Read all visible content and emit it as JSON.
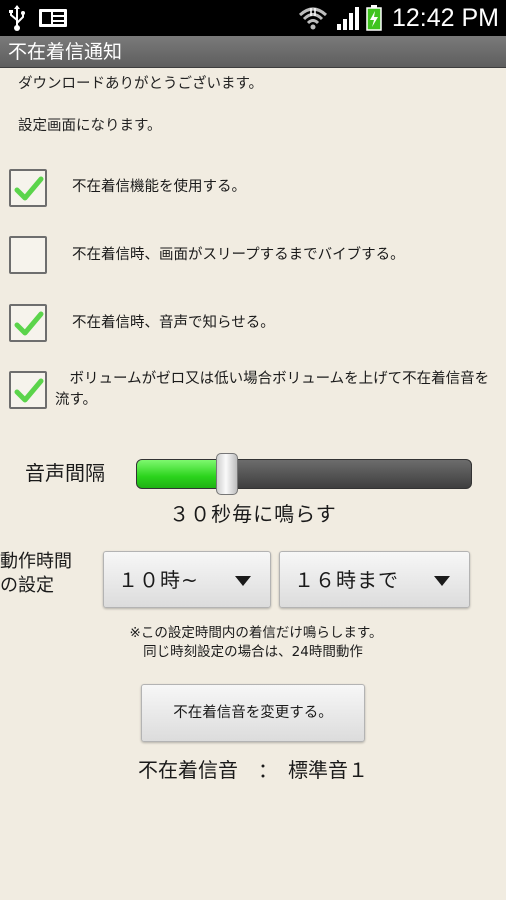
{
  "status_bar": {
    "time": "12:42 PM",
    "icons": [
      "usb-icon",
      "message-icon",
      "wifi-icon",
      "signal-icon",
      "battery-charging-icon"
    ]
  },
  "app": {
    "title": "不在着信通知"
  },
  "intro": {
    "line1": "ダウンロードありがとうございます。",
    "line2": "設定画面になります。"
  },
  "options": [
    {
      "label": "不在着信機能を使用する。",
      "checked": true
    },
    {
      "label": "不在着信時、画面がスリープするまでバイブする。",
      "checked": false
    },
    {
      "label": "不在着信時、音声で知らせる。",
      "checked": true
    },
    {
      "label": "　ボリュームがゼロ又は低い場合ボリュームを上げて不在着信音を流す。",
      "checked": true
    }
  ],
  "interval": {
    "label": "音声間隔",
    "value_text": "３０秒毎に鳴らす",
    "level": 0.27,
    "accent": "#2bd31c"
  },
  "operating_time": {
    "label_line1": "動作時間",
    "label_line2": "の設定",
    "start": "１０時~",
    "end": "１６時まで"
  },
  "notes": {
    "line1": "※この設定時間内の着信だけ鳴らします。",
    "line2": "同じ時刻設定の場合は、24時間動作"
  },
  "ringtone": {
    "change_button": "不在着信音を変更する。",
    "display": "不在着信音　：　標準音１"
  }
}
